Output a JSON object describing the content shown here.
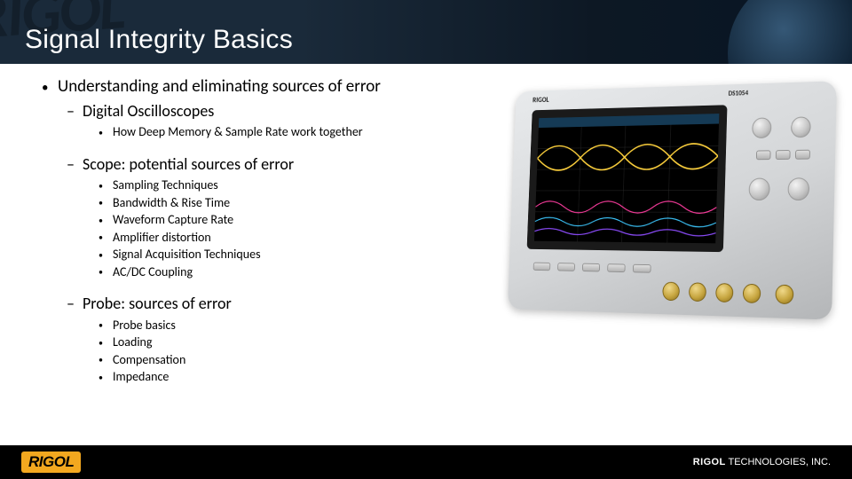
{
  "header": {
    "title": "Signal Integrity Basics",
    "watermark": "RIGOL"
  },
  "bullets": {
    "level1": "Understanding and eliminating sources of error",
    "digital": {
      "label": "Digital Oscilloscopes",
      "sub": [
        "How Deep Memory & Sample Rate work together"
      ]
    },
    "scope": {
      "label": "Scope: potential sources of error",
      "sub": [
        "Sampling Techniques",
        "Bandwidth & Rise Time",
        "Waveform Capture Rate",
        "Amplifier distortion",
        "Signal Acquisition Techniques",
        "AC/DC Coupling"
      ]
    },
    "probe": {
      "label": "Probe: sources of error",
      "sub": [
        "Probe basics",
        "Loading",
        "Compensation",
        "Impedance"
      ]
    }
  },
  "image": {
    "name": "oscilloscope-photo",
    "brand": "RIGOL",
    "model": "DS1054"
  },
  "footer": {
    "logo": "RIGOL",
    "company_bold": "RIGOL",
    "company_rest": " TECHNOLOGIES, INC."
  }
}
